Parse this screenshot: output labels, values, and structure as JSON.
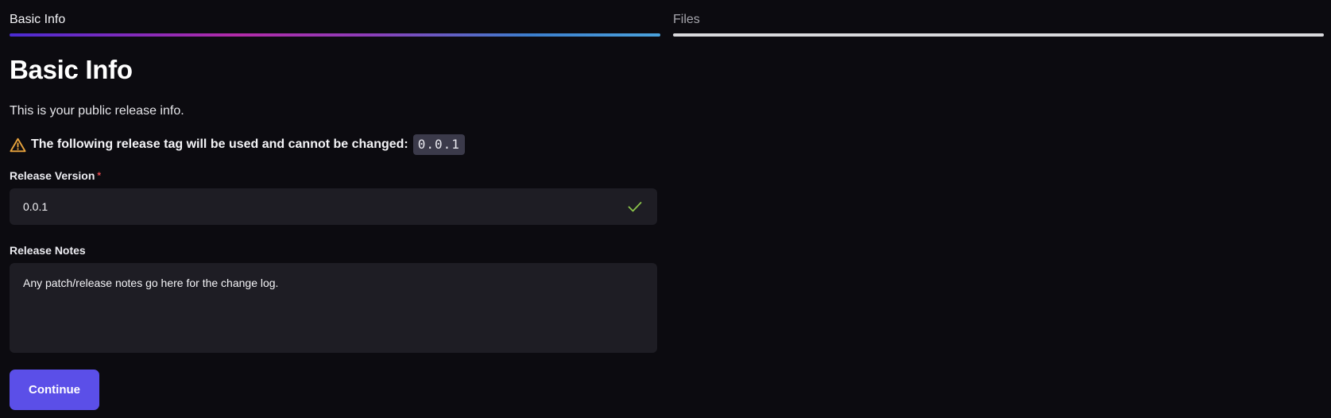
{
  "steps": [
    {
      "label": "Basic Info",
      "state": "active"
    },
    {
      "label": "Files",
      "state": "inactive"
    }
  ],
  "page": {
    "title": "Basic Info",
    "subtitle": "This is your public release info.",
    "warning": {
      "icon": "warning-triangle-icon",
      "text": "The following release tag will be used and cannot be changed:",
      "tag": "0.0.1"
    }
  },
  "form": {
    "release_version": {
      "label": "Release Version",
      "required_marker": "*",
      "value": "0.0.1",
      "status_icon": "check-icon"
    },
    "release_notes": {
      "label": "Release Notes",
      "value": "Any patch/release notes go here for the change log."
    },
    "continue_label": "Continue"
  },
  "colors": {
    "background": "#0c0b10",
    "field_background": "#1e1d24",
    "accent": "#5b4fe8",
    "warning": "#e8a33d",
    "success": "#8bc34a",
    "required": "#e5484d"
  }
}
